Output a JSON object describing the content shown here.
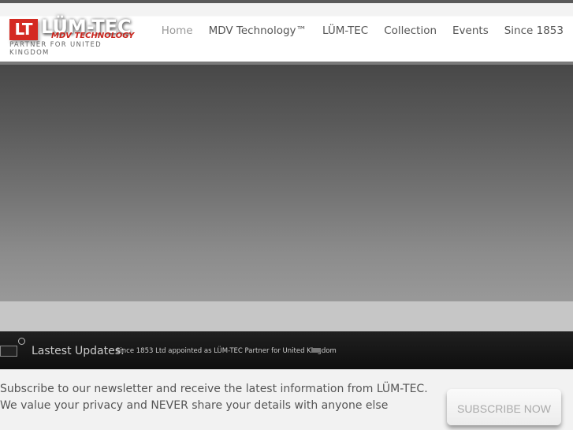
{
  "logo": {
    "mark": "LT",
    "brand": "LÜM-TEC",
    "sub": "MDV TECHNOLOGY",
    "tagline": "PARTNER FOR UNITED KINGDOM"
  },
  "nav": [
    "Home",
    "MDV Technology™",
    "LÜM-TEC",
    "Collection",
    "Events",
    "Since 1853"
  ],
  "updates": {
    "label": "Lastest Updates:",
    "text": "Since 1853 Ltd appointed as LÜM-TEC Partner for United Kingdom"
  },
  "newsletter": {
    "text": "Subscribe to our newsletter and receive the latest information from LÜM-TEC. We value your privacy and NEVER share your details with anyone else",
    "button": "SUBSCRIBE NOW"
  }
}
